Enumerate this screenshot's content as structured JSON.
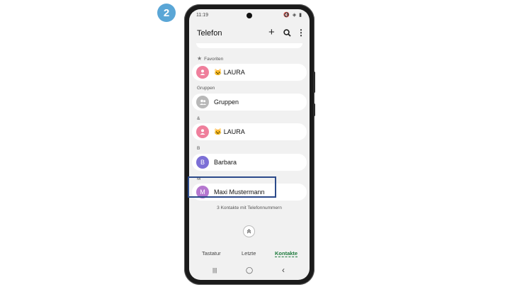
{
  "step": "2",
  "status": {
    "time": "11:19",
    "icons": "🔇 ◈ ▮"
  },
  "appbar": {
    "title": "Telefon",
    "add_icon": "+",
    "search_icon": "⌕",
    "more_icon": "⋮"
  },
  "sections": {
    "favorites": "Favoriten",
    "groups": "Gruppen",
    "amp": "&",
    "b": "B",
    "m": "M"
  },
  "contacts": [
    {
      "name": "🐱 LAURA",
      "avatar": "",
      "color": "#ef7f9c"
    },
    {
      "name": "Gruppen",
      "avatar": "",
      "color": "#b8b8b8"
    },
    {
      "name": "🐱 LAURA",
      "avatar": "",
      "color": "#ef7f9c"
    },
    {
      "name": "Barbara",
      "avatar": "B",
      "color": "#7c6fd6"
    },
    {
      "name": "Maxi Mustermann",
      "avatar": "M",
      "color": "#b577cf"
    }
  ],
  "contact_count": "3 Kontakte mit Telefonnummern",
  "tabs": [
    "Tastatur",
    "Letzte",
    "Kontakte"
  ],
  "navbar": {
    "recent": "|||",
    "home": "◯",
    "back": "‹"
  }
}
